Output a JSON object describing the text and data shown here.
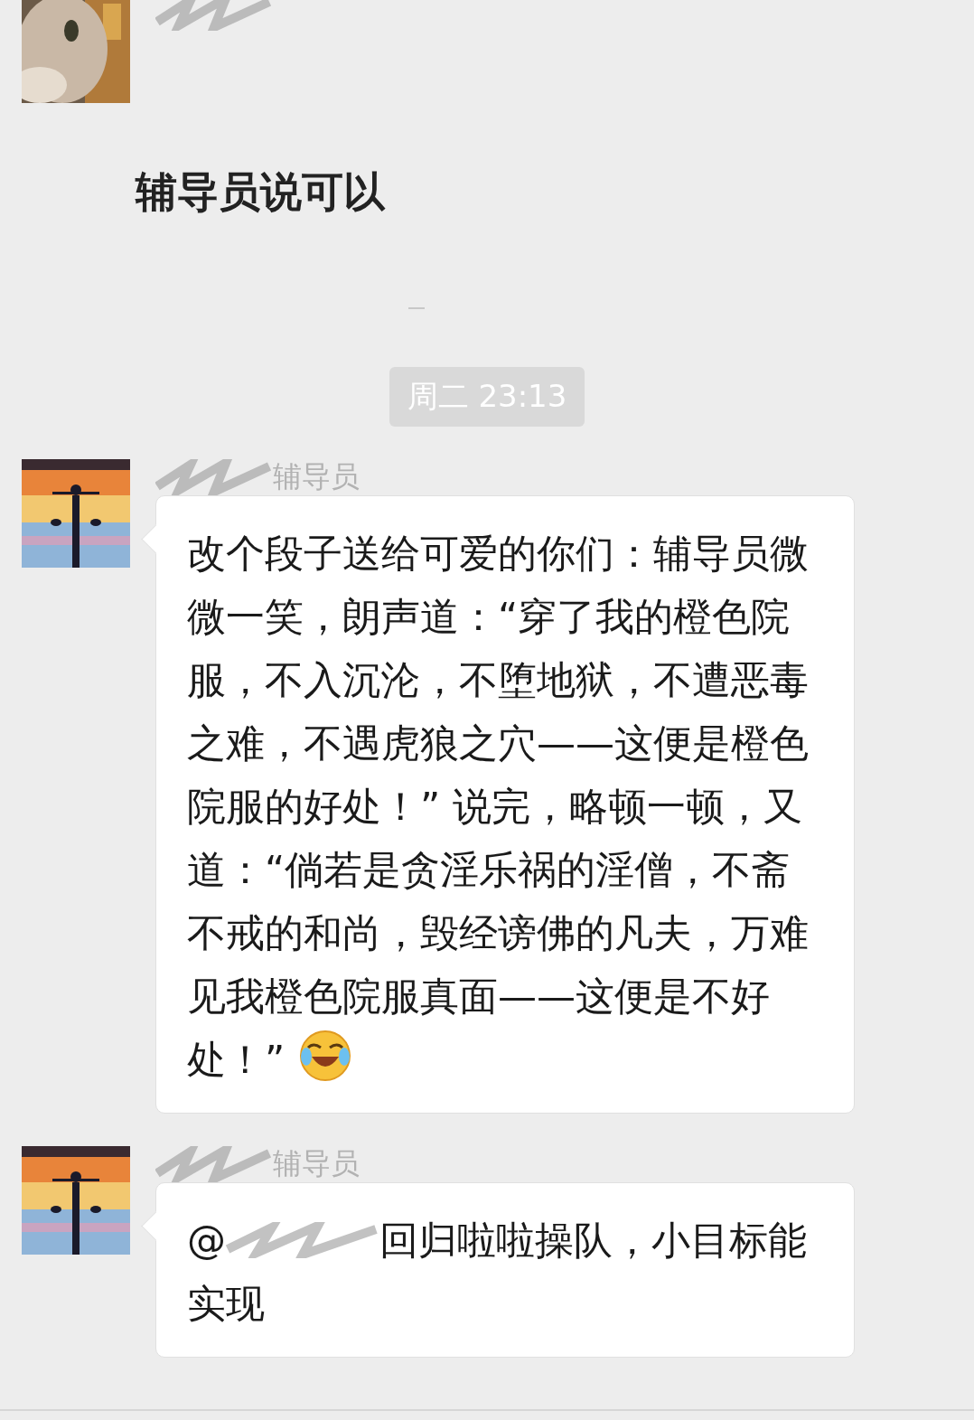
{
  "messages": [
    {
      "kind": "plain",
      "text": "辅导员说可以"
    },
    {
      "kind": "time",
      "text": "周二 23:13"
    },
    {
      "kind": "bubble",
      "sender": "辅导员",
      "text": "改个段子送给可爱的你们：辅导员微微一笑，朗声道：“穿了我的橙色院服，不入沉沦，不堕地狱，不遭恶毒之难，不遇虎狼之穴——这便是橙色院服的好处！” 说完，略顿一顿，又道：“倘若是贪淫乐祸的淫僧，不斋不戒的和尚，毁经谤佛的凡夫，万难见我橙色院服真面——这便是不好处！”",
      "emoji": true
    },
    {
      "kind": "mention",
      "sender": "辅导员",
      "at": "@",
      "lines": [
        "回归啦啦操队，小目标能",
        "实现"
      ]
    }
  ]
}
